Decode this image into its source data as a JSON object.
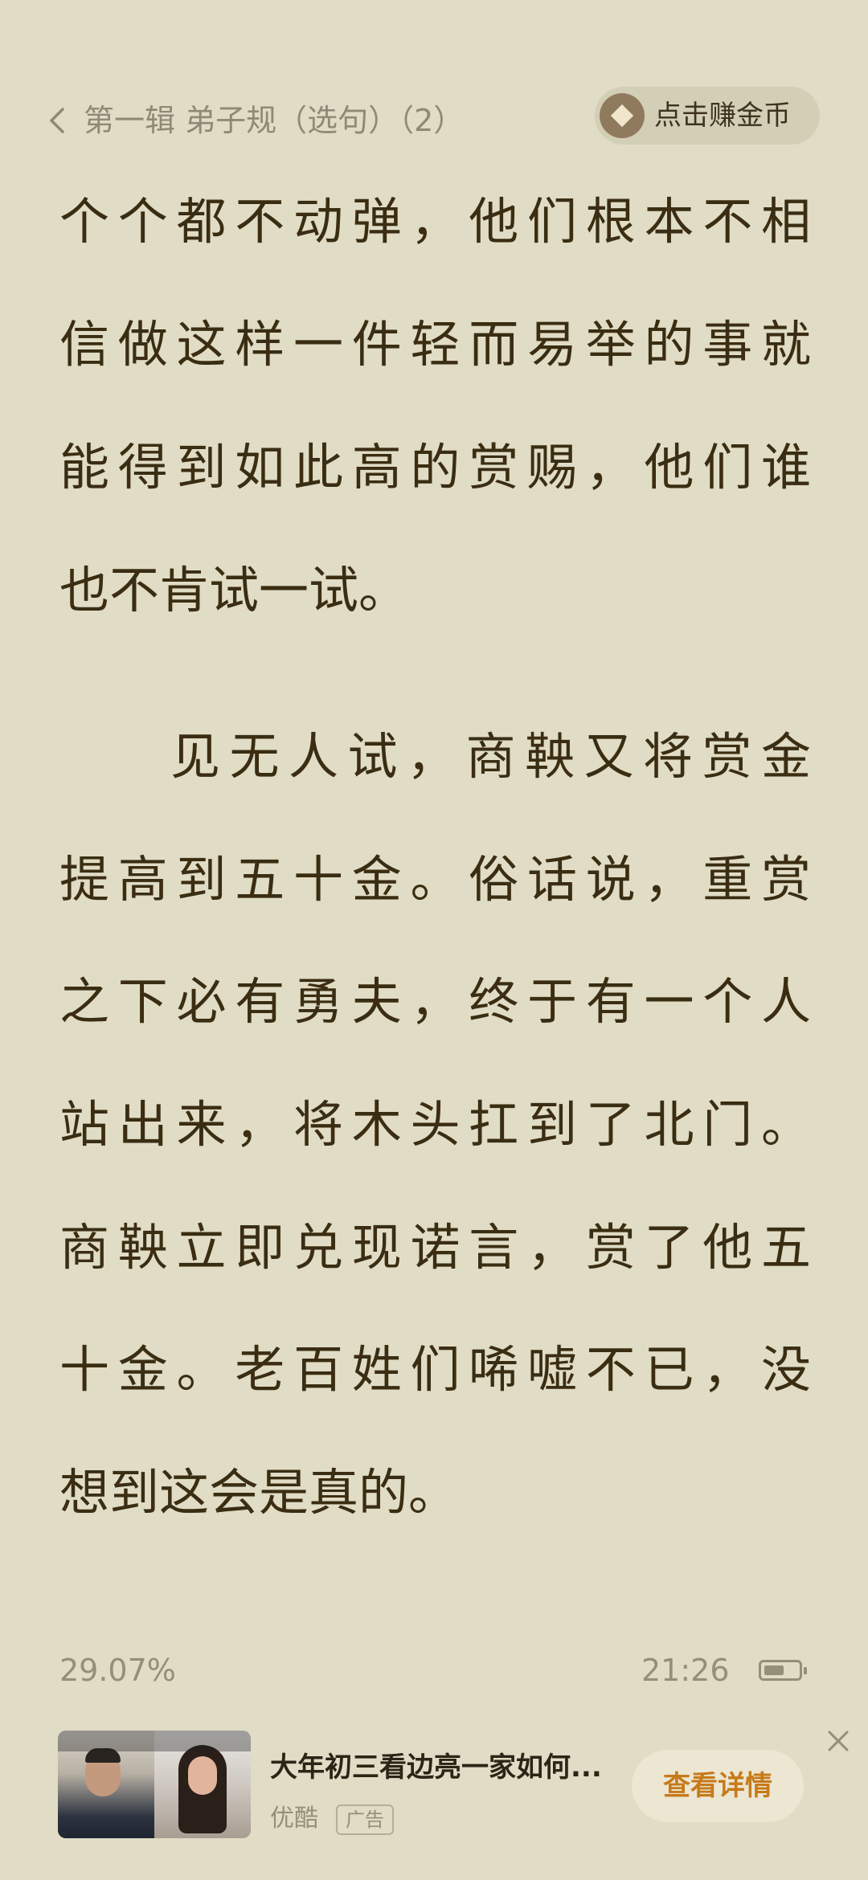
{
  "header": {
    "chapter_title": "第一辑 弟子规（选句）（2）",
    "earn_coins_label": "点击赚金币"
  },
  "content": {
    "lines": [
      "个个都不动弹，他们根本不相",
      "信做这样一件轻而易举的事就",
      "能得到如此高的赏赐，他们谁",
      "也不肯试一试。",
      "见无人试，商鞅又将赏金",
      "提高到五十金。俗话说，重赏",
      "之下必有勇夫，终于有一个人",
      "站出来，将木头扛到了北门。",
      "商鞅立即兑现诺言，赏了他五",
      "十金。老百姓们唏嘘不已，没",
      "想到这会是真的。"
    ]
  },
  "status": {
    "progress": "29.07%",
    "time": "21:26",
    "battery_level": 0.6
  },
  "ad": {
    "title": "大年初三看边亮一家如何...",
    "source": "优酷",
    "tag": "广告",
    "cta_label": "查看详情"
  },
  "colors": {
    "background": "#e0dcc5",
    "body_text": "#3a2d12",
    "muted_text": "#958f7a",
    "cta_text": "#c77a19"
  },
  "icons": {
    "back": "chevron-left-icon",
    "coin": "coin-icon",
    "battery": "battery-icon",
    "close": "close-icon"
  }
}
